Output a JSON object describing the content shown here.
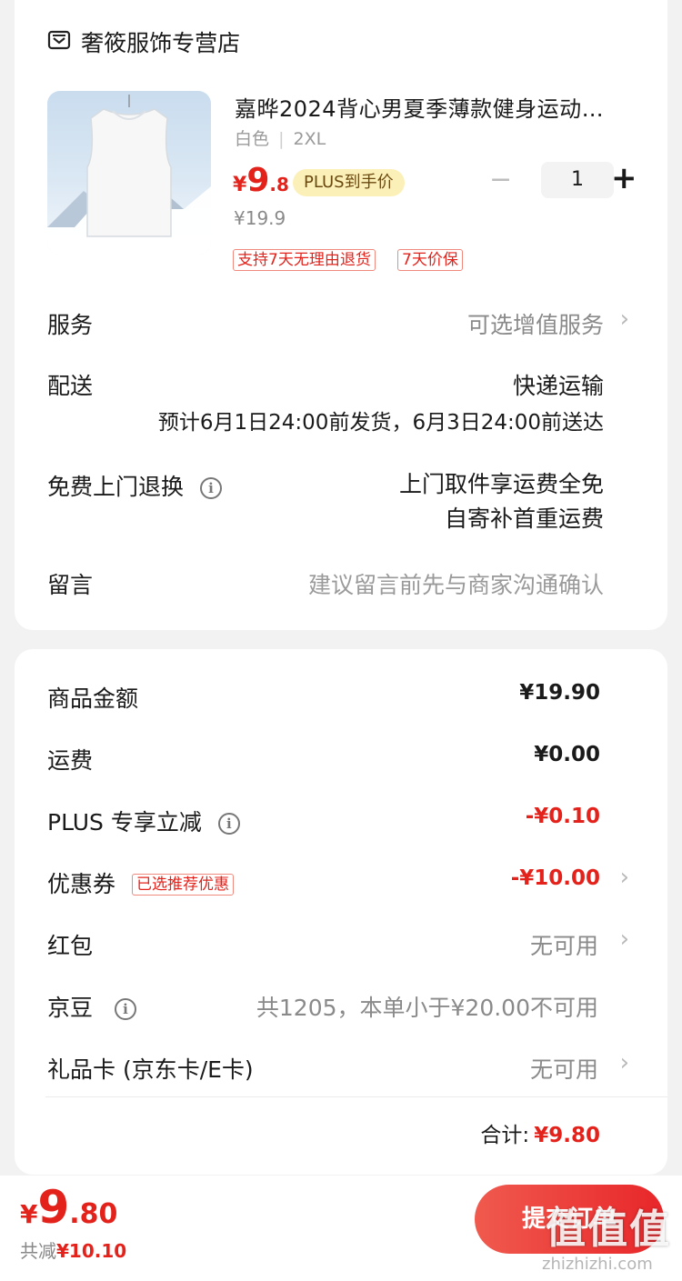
{
  "store": {
    "name": "奢筱服饰专营店"
  },
  "product": {
    "title": "嘉晔2024背心男夏季薄款健身运动…",
    "spec_color": "白色",
    "spec_size": "2XL",
    "price_symbol": "¥",
    "price_int": "9",
    "price_dec": ".8",
    "plus_badge": "PLUS到手价",
    "original_price": "¥19.9",
    "qty_minus": "−",
    "qty_value": "1",
    "qty_plus": "+",
    "tags": [
      "支持7天无理由退货",
      "7天价保"
    ]
  },
  "rows": {
    "service_label": "服务",
    "service_value": "可选增值服务",
    "delivery_label": "配送",
    "delivery_method": "快递运输",
    "delivery_eta": "预计6月1日24:00前发货，6月3日24:00前送达",
    "return_label": "免费上门退换",
    "return_line1": "上门取件享运费全免",
    "return_line2": "自寄补首重运费",
    "message_label": "留言",
    "message_placeholder": "建议留言前先与商家沟通确认"
  },
  "summary": {
    "goods_label": "商品金额",
    "goods_value": "¥19.90",
    "shipping_label": "运费",
    "shipping_value": "¥0.00",
    "plus_label": "PLUS 专享立减",
    "plus_value": "-¥0.10",
    "coupon_label": "优惠券",
    "coupon_tag": "已选推荐优惠",
    "coupon_value": "-¥10.00",
    "redpacket_label": "红包",
    "redpacket_value": "无可用",
    "jingdou_label": "京豆",
    "jingdou_value": "共1205，本单小于¥20.00不可用",
    "giftcard_label": "礼品卡 (京东卡/E卡)",
    "giftcard_value": "无可用",
    "total_label": "合计:",
    "total_value": "¥9.80"
  },
  "bottom_bar": {
    "price_symbol": "¥",
    "price_int": "9",
    "price_dec": ".80",
    "saved_label": "共减",
    "saved_value": "¥10.10",
    "submit_label": "提交订单"
  },
  "watermark": {
    "text": "值值值",
    "url": "zhizhizhi.com"
  },
  "colors": {
    "accent_red": "#e3221b",
    "plus_yellow": "#fcf0b9",
    "background": "#f2f2f2"
  },
  "icons": [
    "store-icon",
    "info-icon",
    "chevron-right-icon"
  ]
}
